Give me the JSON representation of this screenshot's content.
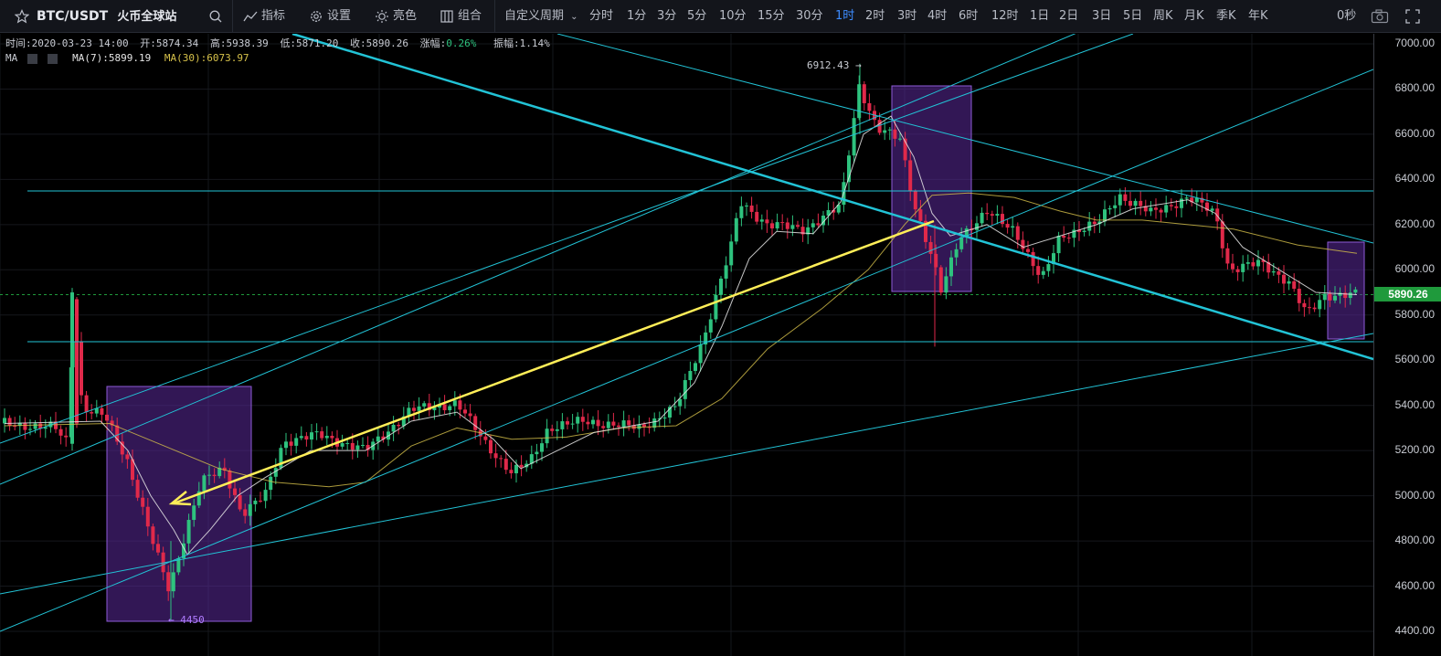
{
  "toolbar": {
    "symbol": "BTC/USDT",
    "exchange": "火币全球站",
    "indicators_label": "指标",
    "settings_label": "设置",
    "theme_label": "亮色",
    "layout_label": "组合",
    "custom_period_label": "自定义周期",
    "periods": [
      "分时",
      "1分",
      "3分",
      "5分",
      "10分",
      "15分",
      "30分",
      "1时",
      "2时",
      "3时",
      "4时",
      "6时",
      "12时",
      "1日",
      "2日",
      "3日",
      "5日",
      "周K",
      "月K",
      "季K",
      "年K"
    ],
    "active_period": "1时",
    "countdown": "0秒",
    "icons": [
      "star-icon",
      "search-icon",
      "indicator-icon",
      "gear-icon",
      "sun-icon",
      "layout-icon",
      "camera-icon",
      "fullscreen-icon"
    ]
  },
  "ohlc": {
    "time": "时间:2020-03-23 14:00",
    "open": "开:5874.34",
    "high": "高:5938.39",
    "low": "低:5871.20",
    "close": "收:5890.26",
    "change_label": "涨幅:",
    "change_value": "0.26%",
    "amplitude": "振幅:1.14%"
  },
  "ma": {
    "label": "MA",
    "ma7": "MA(7):5899.19",
    "ma30": "MA(30):6073.97",
    "ma7_color": "#e6e6e6",
    "ma30_color": "#d6c14a"
  },
  "axis": {
    "ticks": [
      "7000.00",
      "6800.00",
      "6600.00",
      "6400.00",
      "6200.00",
      "6000.00",
      "5800.00",
      "5600.00",
      "5400.00",
      "5200.00",
      "5000.00",
      "4800.00",
      "4600.00",
      "4400.00"
    ],
    "current_price": "5890.26"
  },
  "annotations": {
    "high_marker": "6912.43 →",
    "low_marker": "← 4450"
  },
  "colors": {
    "up": "#2ec27e",
    "down": "#e0294a",
    "trendline": "#22c3d6",
    "arrow": "#ffee58",
    "box_fill": "#5b2a9a",
    "box_stroke": "#8e5bd8"
  }
}
